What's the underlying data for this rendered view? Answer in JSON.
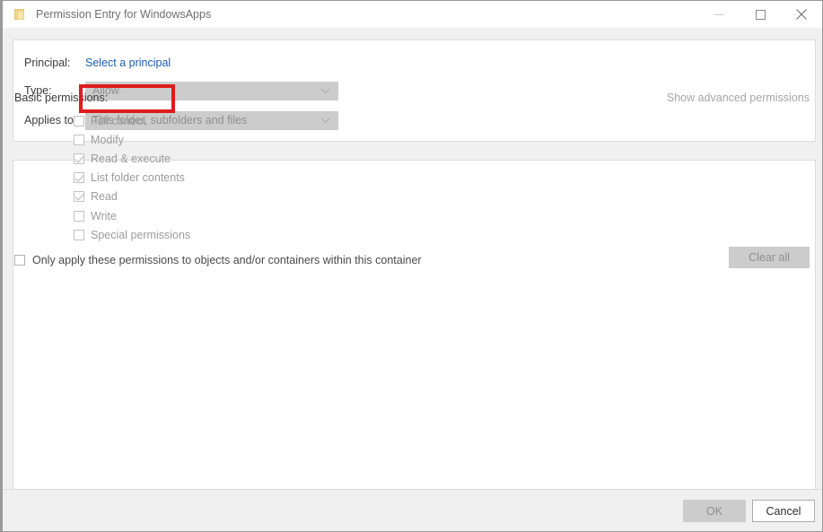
{
  "window": {
    "title": "Permission Entry for WindowsApps",
    "icon": "folder-icon",
    "controls": {
      "minimize": "minimize-icon",
      "maximize": "maximize-icon",
      "close": "close-icon"
    }
  },
  "principal": {
    "label": "Principal:",
    "link_text": "Select a principal",
    "highlight_color": "#e01b1b",
    "link_color": "#1a5fb4"
  },
  "type": {
    "label": "Type:",
    "value": "Allow",
    "disabled": true
  },
  "applies_to": {
    "label": "Applies to:",
    "value": "This folder, subfolders and files",
    "disabled": true
  },
  "permissions": {
    "section_label": "Basic permissions:",
    "advanced_link": "Show advanced permissions",
    "items": [
      {
        "label": "Full control",
        "checked": false
      },
      {
        "label": "Modify",
        "checked": false
      },
      {
        "label": "Read & execute",
        "checked": true
      },
      {
        "label": "List folder contents",
        "checked": true
      },
      {
        "label": "Read",
        "checked": true
      },
      {
        "label": "Write",
        "checked": false
      },
      {
        "label": "Special permissions",
        "checked": false
      }
    ]
  },
  "only_apply": {
    "label": "Only apply these permissions to objects and/or containers within this container",
    "checked": false
  },
  "clear_all": {
    "label": "Clear all",
    "disabled": true
  },
  "footer": {
    "ok_label": "OK",
    "ok_disabled": true,
    "cancel_label": "Cancel"
  }
}
